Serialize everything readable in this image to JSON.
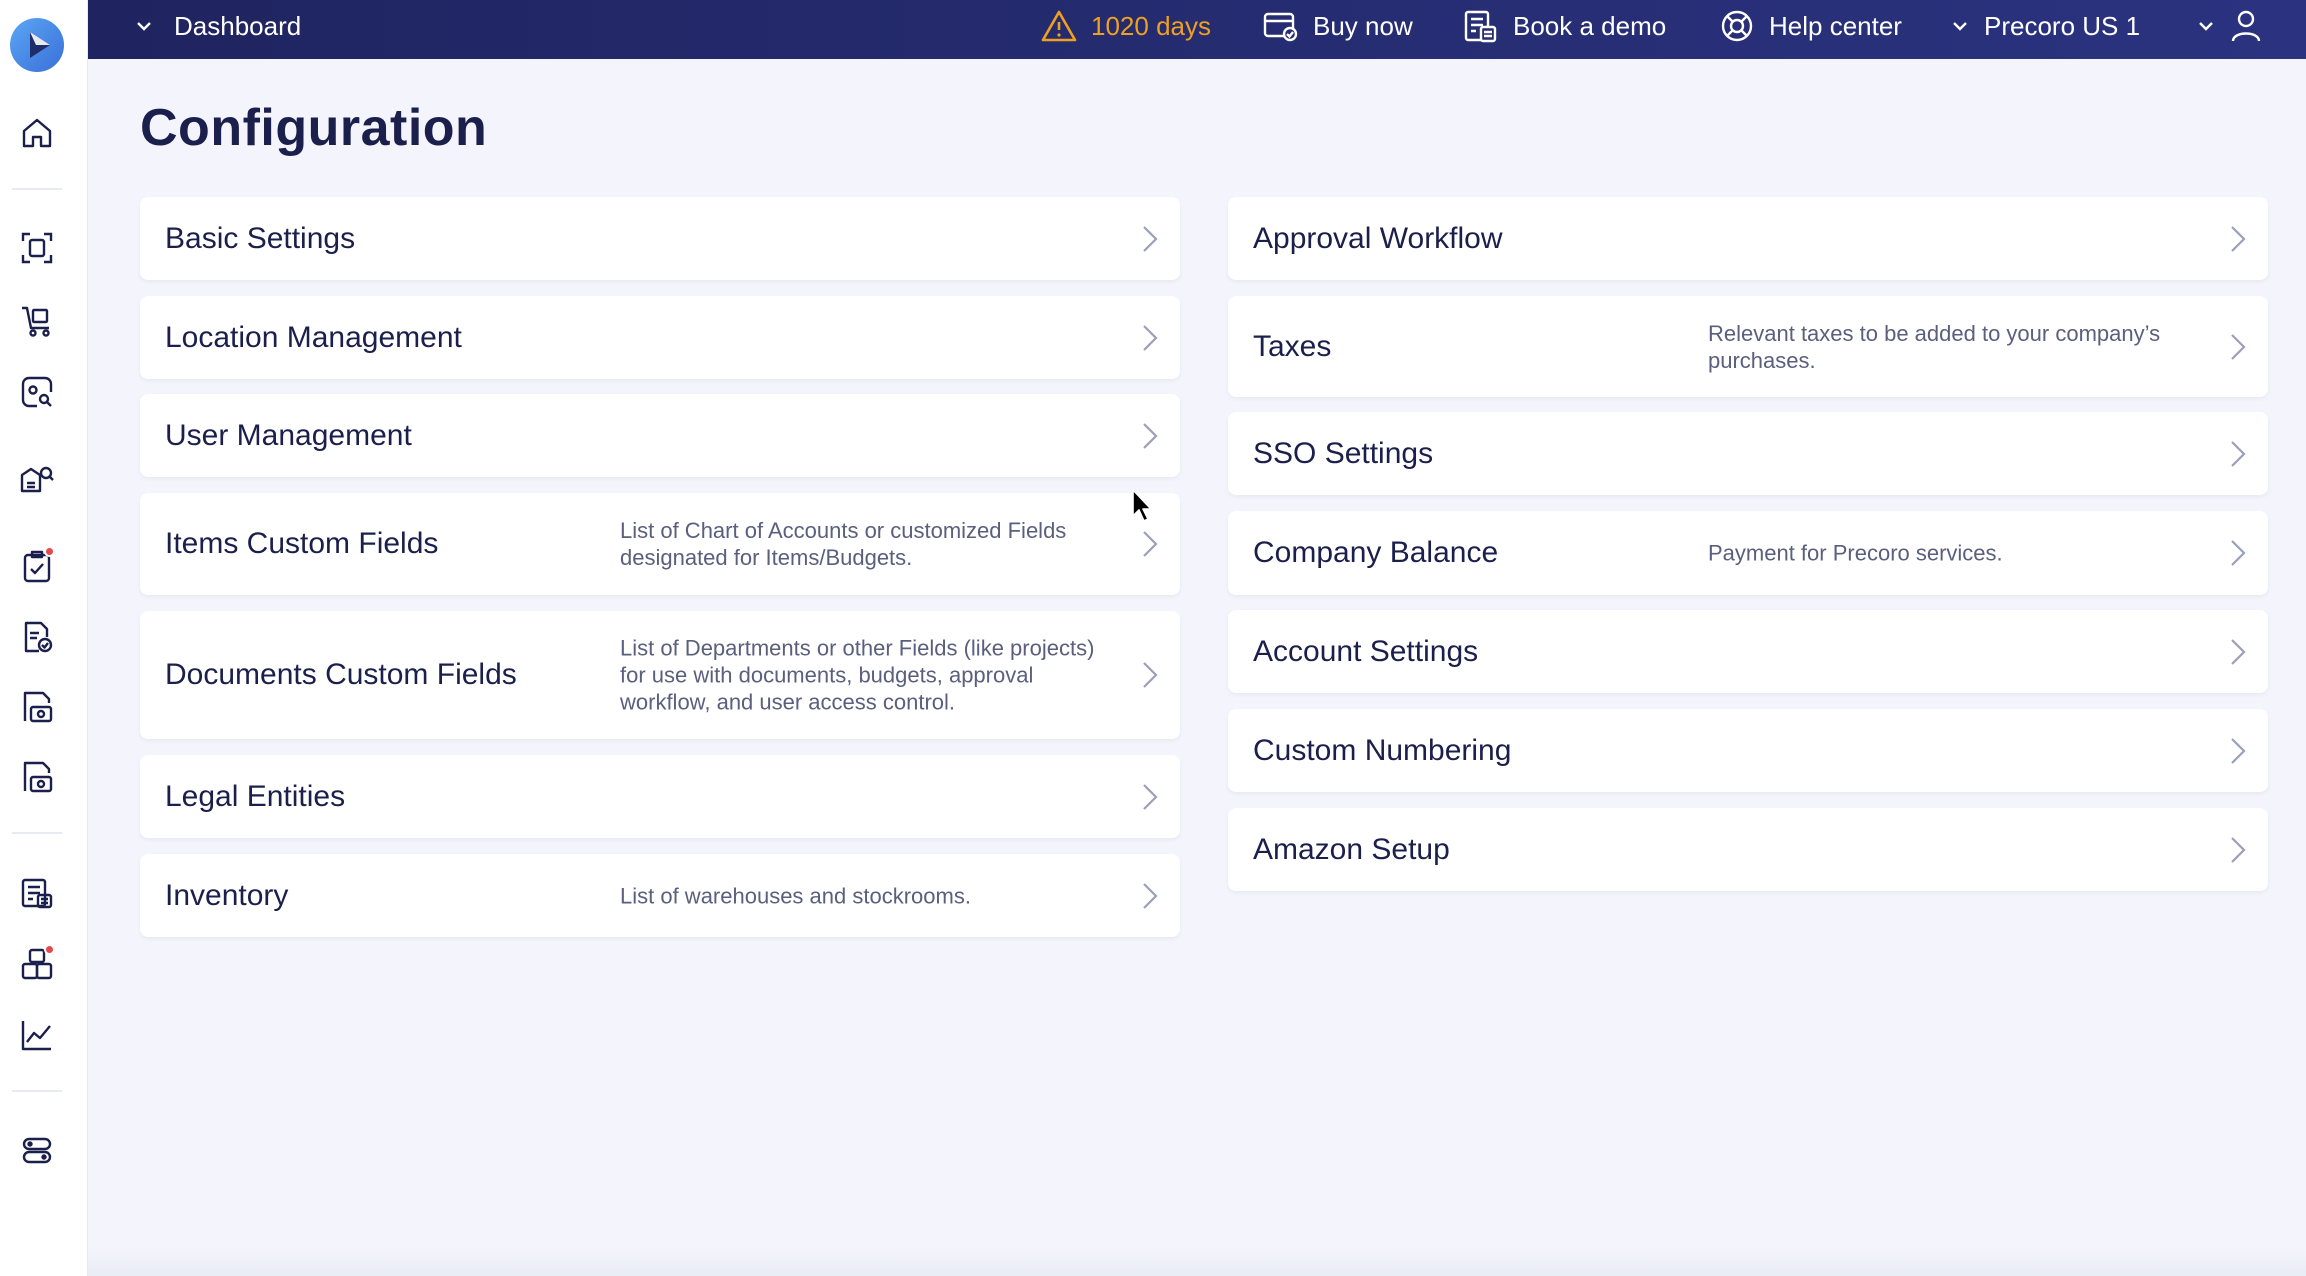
{
  "topbar": {
    "dashboard_label": "Dashboard",
    "trial_days": "1020 days",
    "buy_now": "Buy now",
    "book_demo": "Book a demo",
    "help_center": "Help center",
    "company": "Precoro US 1"
  },
  "page": {
    "title": "Configuration"
  },
  "left_cards": [
    {
      "title": "Basic Settings",
      "desc": ""
    },
    {
      "title": "Location Management",
      "desc": ""
    },
    {
      "title": "User Management",
      "desc": ""
    },
    {
      "title": "Items Custom Fields",
      "desc": "List of Chart of Accounts or customized Fields designated for Items/Budgets."
    },
    {
      "title": "Documents Custom Fields",
      "desc": "List of Departments or other Fields (like projects) for use with documents, budgets, approval workflow, and user access control."
    },
    {
      "title": "Legal Entities",
      "desc": ""
    },
    {
      "title": "Inventory",
      "desc": "List of warehouses and stockrooms."
    }
  ],
  "right_cards": [
    {
      "title": "Approval Workflow",
      "desc": ""
    },
    {
      "title": "Taxes",
      "desc": "Relevant taxes to be added to your company’s purchases."
    },
    {
      "title": "SSO Settings",
      "desc": ""
    },
    {
      "title": "Company Balance",
      "desc": "Payment for Precoro services."
    },
    {
      "title": "Account Settings",
      "desc": ""
    },
    {
      "title": "Custom Numbering",
      "desc": ""
    },
    {
      "title": "Amazon Setup",
      "desc": ""
    }
  ],
  "sidebar": {
    "icons": [
      "home-icon",
      "scan-icon",
      "cart-icon",
      "search-doc-icon",
      "supplier-search-icon",
      "approval-icon",
      "invoice-check-icon",
      "receipt-icon",
      "payment-icon",
      "budget-icon",
      "inventory-icon",
      "analytics-icon",
      "settings-toggle-icon"
    ]
  },
  "colors": {
    "topbar": "#1f2460",
    "accent_orange": "#f0a020",
    "notification": "#e5484d",
    "background": "#f4f5fc"
  }
}
